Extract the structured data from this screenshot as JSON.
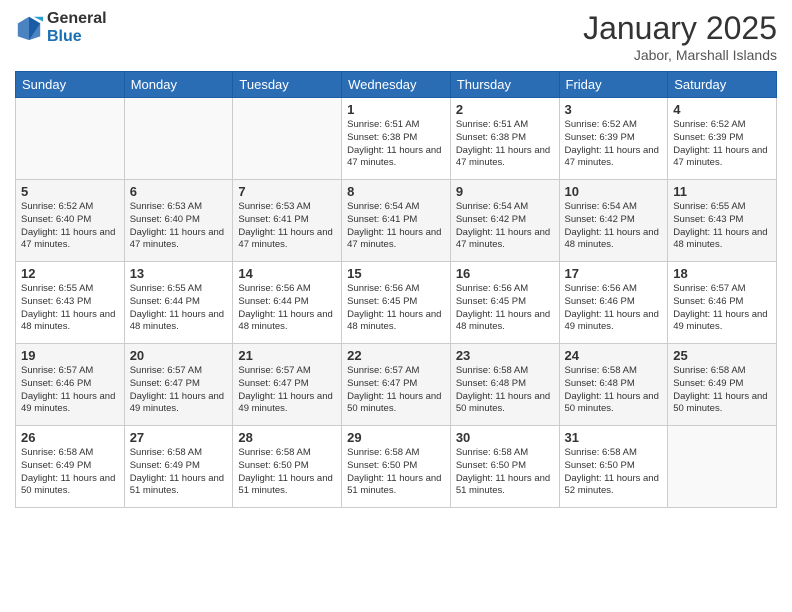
{
  "header": {
    "logo_general": "General",
    "logo_blue": "Blue",
    "month_title": "January 2025",
    "location": "Jabor, Marshall Islands"
  },
  "days_of_week": [
    "Sunday",
    "Monday",
    "Tuesday",
    "Wednesday",
    "Thursday",
    "Friday",
    "Saturday"
  ],
  "weeks": [
    [
      {
        "day": "",
        "sunrise": "",
        "sunset": "",
        "daylight": ""
      },
      {
        "day": "",
        "sunrise": "",
        "sunset": "",
        "daylight": ""
      },
      {
        "day": "",
        "sunrise": "",
        "sunset": "",
        "daylight": ""
      },
      {
        "day": "1",
        "sunrise": "Sunrise: 6:51 AM",
        "sunset": "Sunset: 6:38 PM",
        "daylight": "Daylight: 11 hours and 47 minutes."
      },
      {
        "day": "2",
        "sunrise": "Sunrise: 6:51 AM",
        "sunset": "Sunset: 6:38 PM",
        "daylight": "Daylight: 11 hours and 47 minutes."
      },
      {
        "day": "3",
        "sunrise": "Sunrise: 6:52 AM",
        "sunset": "Sunset: 6:39 PM",
        "daylight": "Daylight: 11 hours and 47 minutes."
      },
      {
        "day": "4",
        "sunrise": "Sunrise: 6:52 AM",
        "sunset": "Sunset: 6:39 PM",
        "daylight": "Daylight: 11 hours and 47 minutes."
      }
    ],
    [
      {
        "day": "5",
        "sunrise": "Sunrise: 6:52 AM",
        "sunset": "Sunset: 6:40 PM",
        "daylight": "Daylight: 11 hours and 47 minutes."
      },
      {
        "day": "6",
        "sunrise": "Sunrise: 6:53 AM",
        "sunset": "Sunset: 6:40 PM",
        "daylight": "Daylight: 11 hours and 47 minutes."
      },
      {
        "day": "7",
        "sunrise": "Sunrise: 6:53 AM",
        "sunset": "Sunset: 6:41 PM",
        "daylight": "Daylight: 11 hours and 47 minutes."
      },
      {
        "day": "8",
        "sunrise": "Sunrise: 6:54 AM",
        "sunset": "Sunset: 6:41 PM",
        "daylight": "Daylight: 11 hours and 47 minutes."
      },
      {
        "day": "9",
        "sunrise": "Sunrise: 6:54 AM",
        "sunset": "Sunset: 6:42 PM",
        "daylight": "Daylight: 11 hours and 47 minutes."
      },
      {
        "day": "10",
        "sunrise": "Sunrise: 6:54 AM",
        "sunset": "Sunset: 6:42 PM",
        "daylight": "Daylight: 11 hours and 48 minutes."
      },
      {
        "day": "11",
        "sunrise": "Sunrise: 6:55 AM",
        "sunset": "Sunset: 6:43 PM",
        "daylight": "Daylight: 11 hours and 48 minutes."
      }
    ],
    [
      {
        "day": "12",
        "sunrise": "Sunrise: 6:55 AM",
        "sunset": "Sunset: 6:43 PM",
        "daylight": "Daylight: 11 hours and 48 minutes."
      },
      {
        "day": "13",
        "sunrise": "Sunrise: 6:55 AM",
        "sunset": "Sunset: 6:44 PM",
        "daylight": "Daylight: 11 hours and 48 minutes."
      },
      {
        "day": "14",
        "sunrise": "Sunrise: 6:56 AM",
        "sunset": "Sunset: 6:44 PM",
        "daylight": "Daylight: 11 hours and 48 minutes."
      },
      {
        "day": "15",
        "sunrise": "Sunrise: 6:56 AM",
        "sunset": "Sunset: 6:45 PM",
        "daylight": "Daylight: 11 hours and 48 minutes."
      },
      {
        "day": "16",
        "sunrise": "Sunrise: 6:56 AM",
        "sunset": "Sunset: 6:45 PM",
        "daylight": "Daylight: 11 hours and 48 minutes."
      },
      {
        "day": "17",
        "sunrise": "Sunrise: 6:56 AM",
        "sunset": "Sunset: 6:46 PM",
        "daylight": "Daylight: 11 hours and 49 minutes."
      },
      {
        "day": "18",
        "sunrise": "Sunrise: 6:57 AM",
        "sunset": "Sunset: 6:46 PM",
        "daylight": "Daylight: 11 hours and 49 minutes."
      }
    ],
    [
      {
        "day": "19",
        "sunrise": "Sunrise: 6:57 AM",
        "sunset": "Sunset: 6:46 PM",
        "daylight": "Daylight: 11 hours and 49 minutes."
      },
      {
        "day": "20",
        "sunrise": "Sunrise: 6:57 AM",
        "sunset": "Sunset: 6:47 PM",
        "daylight": "Daylight: 11 hours and 49 minutes."
      },
      {
        "day": "21",
        "sunrise": "Sunrise: 6:57 AM",
        "sunset": "Sunset: 6:47 PM",
        "daylight": "Daylight: 11 hours and 49 minutes."
      },
      {
        "day": "22",
        "sunrise": "Sunrise: 6:57 AM",
        "sunset": "Sunset: 6:47 PM",
        "daylight": "Daylight: 11 hours and 50 minutes."
      },
      {
        "day": "23",
        "sunrise": "Sunrise: 6:58 AM",
        "sunset": "Sunset: 6:48 PM",
        "daylight": "Daylight: 11 hours and 50 minutes."
      },
      {
        "day": "24",
        "sunrise": "Sunrise: 6:58 AM",
        "sunset": "Sunset: 6:48 PM",
        "daylight": "Daylight: 11 hours and 50 minutes."
      },
      {
        "day": "25",
        "sunrise": "Sunrise: 6:58 AM",
        "sunset": "Sunset: 6:49 PM",
        "daylight": "Daylight: 11 hours and 50 minutes."
      }
    ],
    [
      {
        "day": "26",
        "sunrise": "Sunrise: 6:58 AM",
        "sunset": "Sunset: 6:49 PM",
        "daylight": "Daylight: 11 hours and 50 minutes."
      },
      {
        "day": "27",
        "sunrise": "Sunrise: 6:58 AM",
        "sunset": "Sunset: 6:49 PM",
        "daylight": "Daylight: 11 hours and 51 minutes."
      },
      {
        "day": "28",
        "sunrise": "Sunrise: 6:58 AM",
        "sunset": "Sunset: 6:50 PM",
        "daylight": "Daylight: 11 hours and 51 minutes."
      },
      {
        "day": "29",
        "sunrise": "Sunrise: 6:58 AM",
        "sunset": "Sunset: 6:50 PM",
        "daylight": "Daylight: 11 hours and 51 minutes."
      },
      {
        "day": "30",
        "sunrise": "Sunrise: 6:58 AM",
        "sunset": "Sunset: 6:50 PM",
        "daylight": "Daylight: 11 hours and 51 minutes."
      },
      {
        "day": "31",
        "sunrise": "Sunrise: 6:58 AM",
        "sunset": "Sunset: 6:50 PM",
        "daylight": "Daylight: 11 hours and 52 minutes."
      },
      {
        "day": "",
        "sunrise": "",
        "sunset": "",
        "daylight": ""
      }
    ]
  ]
}
